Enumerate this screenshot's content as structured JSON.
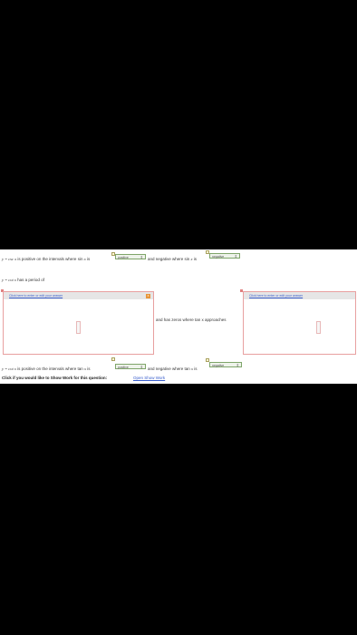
{
  "q1": {
    "prefix": "y = csc ",
    "var": "x",
    "mid": " is positive on the intervals where sin ",
    "var2": "x",
    "is": " is",
    "dd1": "positive",
    "between": "and negative where sin ",
    "var3": "x",
    "is2": " is",
    "dd2": "negative"
  },
  "q2": {
    "text": "y = cot ",
    "var": "x",
    "rest": " has a period of"
  },
  "answer_box_1": {
    "link": "Click here to enter or edit your answer",
    "close": "x"
  },
  "answer_box_2": {
    "link": "Click here to enter or edit your answer"
  },
  "middle_text": "and has zeros where tan  x  approaches",
  "q3": {
    "prefix": "y = cot ",
    "var": "x",
    "mid": " is positive on the intervals where tan ",
    "var2": "x",
    "is": " is",
    "dd1": "positive",
    "between": "and negative where tan ",
    "var3": "x",
    "is2": " is",
    "dd2": "negative"
  },
  "showwork": {
    "label": "Click if you would like to Show Work for this question:",
    "link": "Open Show Work"
  }
}
